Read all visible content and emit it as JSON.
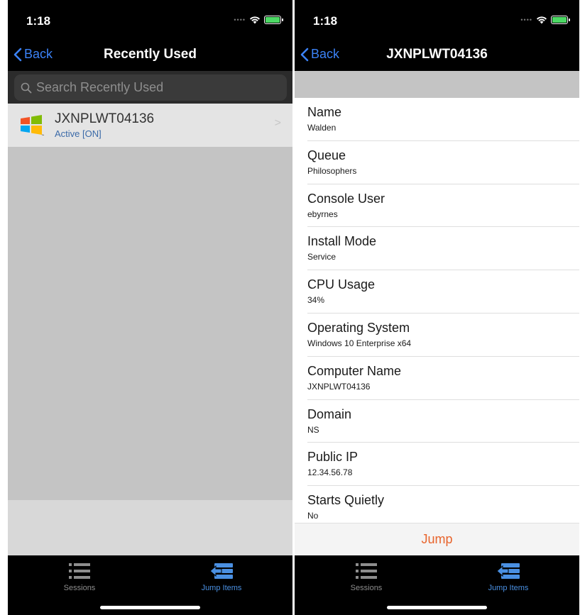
{
  "left": {
    "status": {
      "time": "1:18"
    },
    "nav": {
      "back_label": "Back",
      "title": "Recently Used"
    },
    "search": {
      "placeholder": "Search Recently Used"
    },
    "items": [
      {
        "name": "JXNPLWT04136",
        "status": "Active [ON]"
      }
    ]
  },
  "right": {
    "status": {
      "time": "1:18"
    },
    "nav": {
      "back_label": "Back",
      "title": "JXNPLWT04136"
    },
    "details": [
      {
        "label": "Name",
        "value": "Walden"
      },
      {
        "label": "Queue",
        "value": "Philosophers"
      },
      {
        "label": "Console User",
        "value": "ebyrnes"
      },
      {
        "label": "Install Mode",
        "value": "Service"
      },
      {
        "label": "CPU Usage",
        "value": "34%"
      },
      {
        "label": "Operating System",
        "value": "Windows 10 Enterprise x64"
      },
      {
        "label": "Computer Name",
        "value": "JXNPLWT04136"
      },
      {
        "label": "Domain",
        "value": "NS"
      },
      {
        "label": "Public IP",
        "value": "12.34.56.78"
      },
      {
        "label": "Starts Quietly",
        "value": "No"
      }
    ],
    "jump_label": "Jump"
  },
  "tabs": [
    {
      "label": "Sessions",
      "icon": "list-icon",
      "active": false
    },
    {
      "label": "Jump Items",
      "icon": "jump-items-icon",
      "active": true
    }
  ],
  "colors": {
    "accent_blue": "#3b82f6",
    "jump_orange": "#e8642c",
    "tab_active": "#4a90e2",
    "battery_green": "#4cd964"
  }
}
